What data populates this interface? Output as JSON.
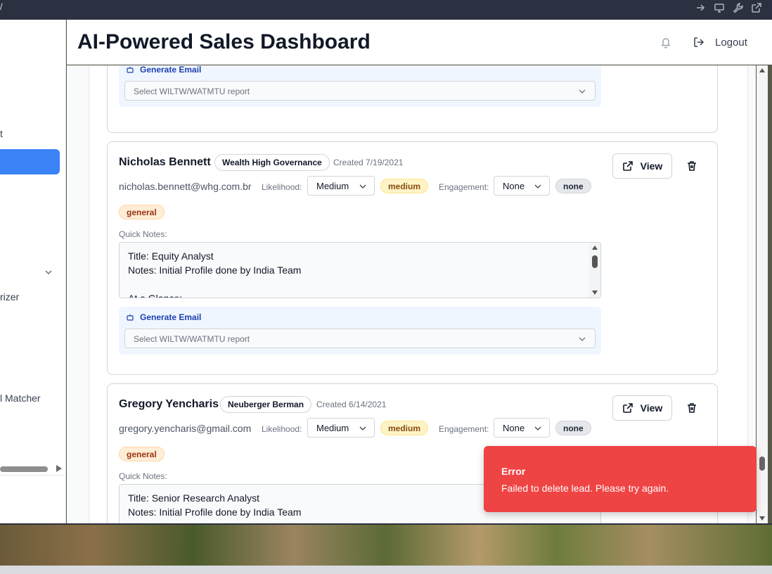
{
  "browser": {
    "url_fragment": "/"
  },
  "header": {
    "title": "AI-Powered Sales Dashboard",
    "logout_label": "Logout"
  },
  "sidebar": {
    "items": [
      {
        "label": "t"
      },
      {
        "label": ""
      },
      {
        "label": "rizer"
      },
      {
        "label": "l Matcher"
      }
    ]
  },
  "generate_email": {
    "label": "Generate Email",
    "placeholder": "Select WILTW/WATMTU report"
  },
  "labels": {
    "likelihood": "Likelihood:",
    "engagement": "Engagement:",
    "quick_notes": "Quick Notes:",
    "view": "View"
  },
  "leads": [
    {
      "name": "Nicholas Bennett",
      "company": "Wealth High Governance",
      "created": "Created 7/19/2021",
      "email": "nicholas.bennett@whg.com.br",
      "likelihood": "Medium",
      "likelihood_badge": "medium",
      "engagement": "None",
      "engagement_badge": "none",
      "category": "general",
      "notes": [
        "Title: Equity Analyst",
        "Notes: Initial Profile done by India Team",
        "",
        "At a Glance:"
      ]
    },
    {
      "name": "Gregory Yencharis",
      "company": "Neuberger Berman",
      "created": "Created 6/14/2021",
      "email": "gregory.yencharis@gmail.com",
      "likelihood": "Medium",
      "likelihood_badge": "medium",
      "engagement": "None",
      "engagement_badge": "none",
      "category": "general",
      "notes": [
        "Title: Senior Research Analyst",
        "Notes: Initial Profile done by India Team"
      ]
    }
  ],
  "toast": {
    "title": "Error",
    "message": "Failed to delete lead. Please try again."
  },
  "icons": {
    "bell": "bell-icon",
    "logout": "logout-icon",
    "robot": "robot-icon",
    "chevron": "chevron-down-icon",
    "external": "external-link-icon",
    "trash": "trash-icon"
  },
  "colors": {
    "accent": "#3b82f6",
    "error": "#ef4444",
    "medium_badge": "#fef3c7",
    "general_badge": "#ffedd5"
  }
}
